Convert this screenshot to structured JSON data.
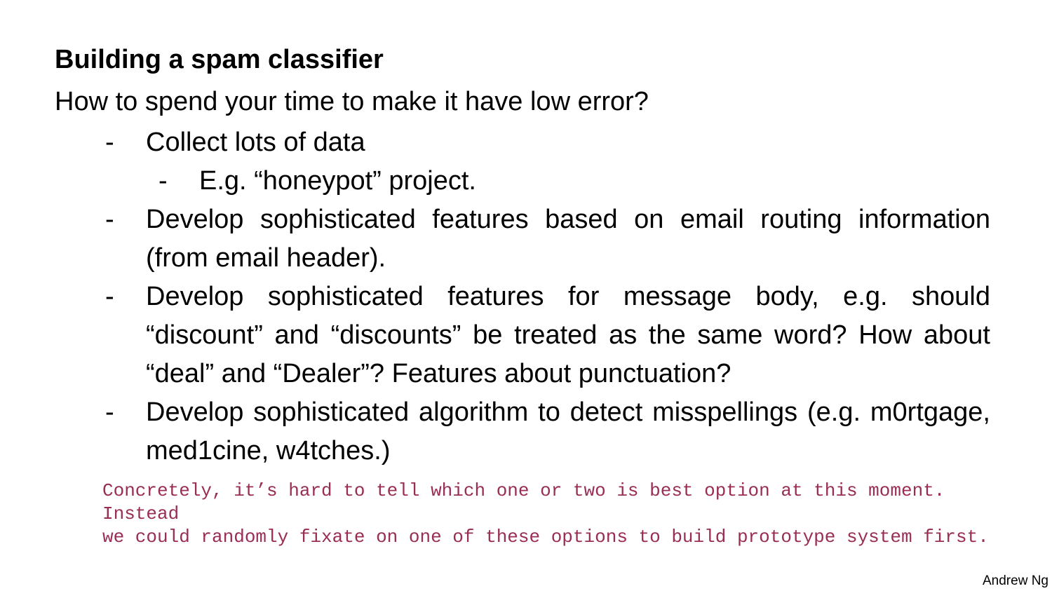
{
  "slide": {
    "title": "Building a spam classifier",
    "subtitle": "How to spend your time to make it have low error?",
    "bullets": [
      {
        "marker": "-",
        "text": "Collect lots of data"
      },
      {
        "marker": "-",
        "text": "E.g. “honeypot” project."
      },
      {
        "marker": "-",
        "text": "Develop sophisticated features based on email routing information (from email header)."
      },
      {
        "marker": "-",
        "text": "Develop sophisticated features for message body, e.g. should “discount” and “discounts” be treated as the same word? How about “deal” and “Dealer”? Features about punctuation?"
      },
      {
        "marker": "-",
        "text": "Develop sophisticated algorithm to detect misspellings (e.g. m0rtgage, med1cine, w4tches.)"
      }
    ],
    "note_line_1": "Concretely, it’s hard to tell which one or two is best option at this moment. Instead",
    "note_line_2": "we could randomly fixate on one of these options to build prototype system first.",
    "author": "Andrew Ng",
    "colors": {
      "text": "#000000",
      "note": "#9a2d55",
      "background": "#ffffff"
    }
  }
}
